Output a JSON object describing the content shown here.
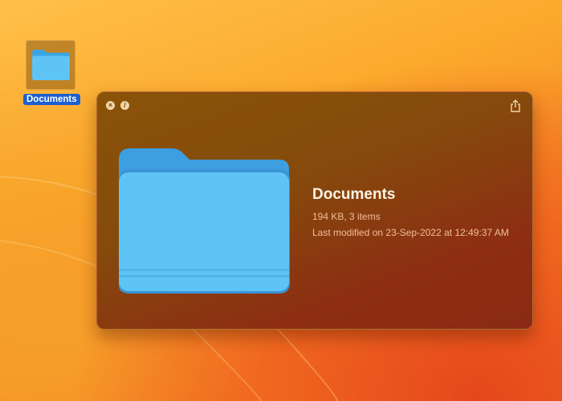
{
  "desktop": {
    "icon_label": "Documents"
  },
  "quicklook": {
    "close_icon": "close-icon",
    "fullscreen_icon": "no-entry-icon",
    "share_icon": "share-icon",
    "title": "Documents",
    "size_items": "194 KB, 3 items",
    "modified": "Last modified on 23-Sep-2022 at 12:49:37 AM"
  },
  "colors": {
    "folder": "#5ec4f6",
    "selection": "#1b5fd0"
  }
}
